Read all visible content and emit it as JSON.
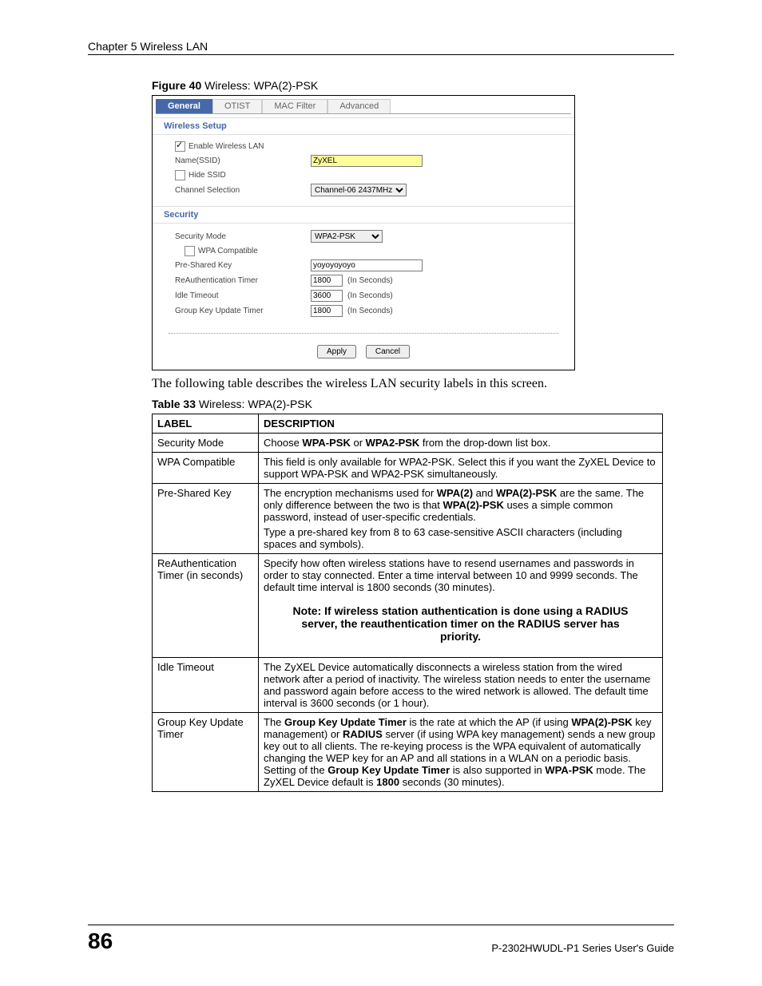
{
  "chapter": "Chapter 5 Wireless LAN",
  "figureCaption": {
    "prefix": "Figure 40",
    "rest": "   Wireless: WPA(2)-PSK"
  },
  "tabs": {
    "general": "General",
    "otist": "OTIST",
    "mac": "MAC Filter",
    "adv": "Advanced"
  },
  "wireless": {
    "panel": "Wireless Setup",
    "enable": "Enable Wireless LAN",
    "nameLbl": "Name(SSID)",
    "nameVal": "ZyXEL",
    "hide": "Hide SSID",
    "chanLbl": "Channel Selection",
    "chanVal": "Channel-06 2437MHz"
  },
  "security": {
    "panel": "Security",
    "modeLbl": "Security Mode",
    "modeVal": "WPA2-PSK",
    "compat": "WPA Compatible",
    "pskLbl": "Pre-Shared Key",
    "pskVal": "yoyoyoyoyo",
    "reauthLbl": "ReAuthentication Timer",
    "reauthVal": "1800",
    "idleLbl": "Idle Timeout",
    "idleVal": "3600",
    "groupLbl": "Group Key Update Timer",
    "groupVal": "1800",
    "sec": "(In Seconds)"
  },
  "buttons": {
    "apply": "Apply",
    "cancel": "Cancel"
  },
  "intro": "The following table describes the wireless LAN security labels in this screen.",
  "tableCaption": {
    "prefix": "Table 33",
    "rest": "   Wireless: WPA(2)-PSK"
  },
  "tableHead": {
    "l": "LABEL",
    "d": "DESCRIPTION"
  },
  "rows": {
    "r1l": "Security Mode",
    "r1d_a": "Choose ",
    "r1d_b": "WPA-PSK",
    "r1d_c": " or ",
    "r1d_d": "WPA2-PSK",
    "r1d_e": " from the drop-down list box.",
    "r2l": "WPA Compatible",
    "r2d": "This field is only available for WPA2-PSK. Select this if you want the ZyXEL Device to support WPA-PSK and WPA2-PSK simultaneously.",
    "r3l": "Pre-Shared Key",
    "r3d_a": "The encryption mechanisms used for ",
    "r3d_b": "WPA(2)",
    "r3d_c": " and ",
    "r3d_d": "WPA(2)-PSK",
    "r3d_e": " are the same. The only difference between the two is that ",
    "r3d_f": "WPA(2)-PSK",
    "r3d_g": " uses a simple common password, instead of user-specific credentials.",
    "r3d_h": "Type a pre-shared key from 8 to 63 case-sensitive ASCII characters (including spaces and symbols).",
    "r4l": "ReAuthentication Timer (in seconds)",
    "r4d": "Specify how often wireless stations have to resend usernames and passwords in order to stay connected. Enter a time interval between 10 and 9999 seconds. The default time interval is 1800 seconds (30 minutes).",
    "r4note": "Note: If wireless station authentication is done using a RADIUS server, the reauthentication timer on the RADIUS server has priority.",
    "r5l": "Idle Timeout",
    "r5d": "The ZyXEL Device automatically disconnects a wireless station from the wired network after a period of inactivity. The wireless station needs to enter the username and password again before access to the wired network is allowed. The default time interval is 3600 seconds (or 1 hour).",
    "r6l": "Group Key Update Timer",
    "r6d_a": "The ",
    "r6d_b": "Group Key Update Timer",
    "r6d_c": " is the rate at which the AP (if using ",
    "r6d_d": "WPA(2)-PSK",
    "r6d_e": " key management) or ",
    "r6d_f": "RADIUS",
    "r6d_g": " server (if using WPA key management) sends a new group key out to all clients. The re-keying process is the WPA equivalent of automatically changing the WEP key for an AP and all stations in a WLAN on a periodic basis. Setting of the ",
    "r6d_h": "Group Key Update Timer",
    "r6d_i": " is also supported in ",
    "r6d_j": "WPA-PSK",
    "r6d_k": " mode. The ZyXEL Device default is ",
    "r6d_l": "1800",
    "r6d_m": " seconds (30 minutes)."
  },
  "footer": {
    "page": "86",
    "guide": "P-2302HWUDL-P1 Series User's Guide"
  }
}
